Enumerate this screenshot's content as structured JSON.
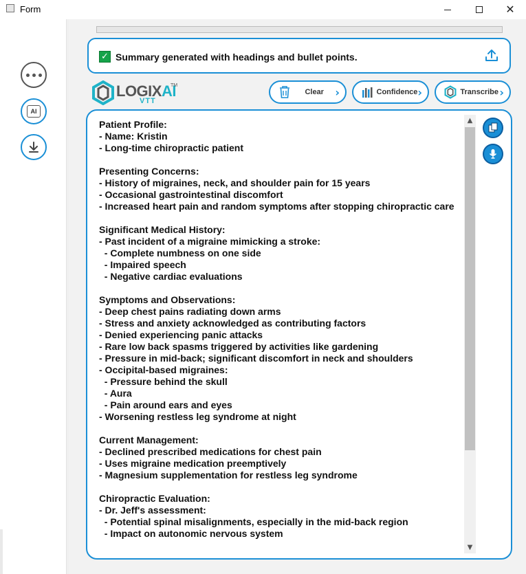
{
  "window": {
    "title": "Form"
  },
  "status": {
    "message": "Summary generated with headings and bullet points.",
    "progress": 1.0
  },
  "logo": {
    "brand_main": "LOGIX",
    "brand_ai": "AI",
    "brand_sub": "VTT",
    "tm": "TM"
  },
  "toolbar": {
    "clear_label": "Clear",
    "confidence_label": "Confidence",
    "transcribe_label": "Transcribe"
  },
  "summary_text": "Patient Profile:\n- Name: Kristin\n- Long-time chiropractic patient\n\nPresenting Concerns:\n- History of migraines, neck, and shoulder pain for 15 years\n- Occasional gastrointestinal discomfort\n- Increased heart pain and random symptoms after stopping chiropractic care\n\nSignificant Medical History:\n- Past incident of a migraine mimicking a stroke:\n  - Complete numbness on one side\n  - Impaired speech\n  - Negative cardiac evaluations\n\nSymptoms and Observations:\n- Deep chest pains radiating down arms\n- Stress and anxiety acknowledged as contributing factors\n- Denied experiencing panic attacks\n- Rare low back spasms triggered by activities like gardening\n- Pressure in mid-back; significant discomfort in neck and shoulders\n- Occipital-based migraines:\n  - Pressure behind the skull\n  - Aura\n  - Pain around ears and eyes\n- Worsening restless leg syndrome at night\n\nCurrent Management:\n- Declined prescribed medications for chest pain\n- Uses migraine medication preemptively\n- Magnesium supplementation for restless leg syndrome\n\nChiropractic Evaluation:\n- Dr. Jeff's assessment:\n  - Potential spinal misalignments, especially in the mid-back region\n  - Impact on autonomic nervous system",
  "icons": {
    "more": "more-icon",
    "ai": "ai-chip-icon",
    "download": "download-icon",
    "upload": "upload-icon",
    "trash": "trash-icon",
    "confidence": "bar-chart-icon",
    "transcribe": "logo-icon",
    "copy": "copy-icon",
    "mic": "microphone-icon"
  },
  "colors": {
    "accent": "#1a8fd6",
    "success": "#16a34a",
    "brand_teal": "#1fb3c8"
  }
}
